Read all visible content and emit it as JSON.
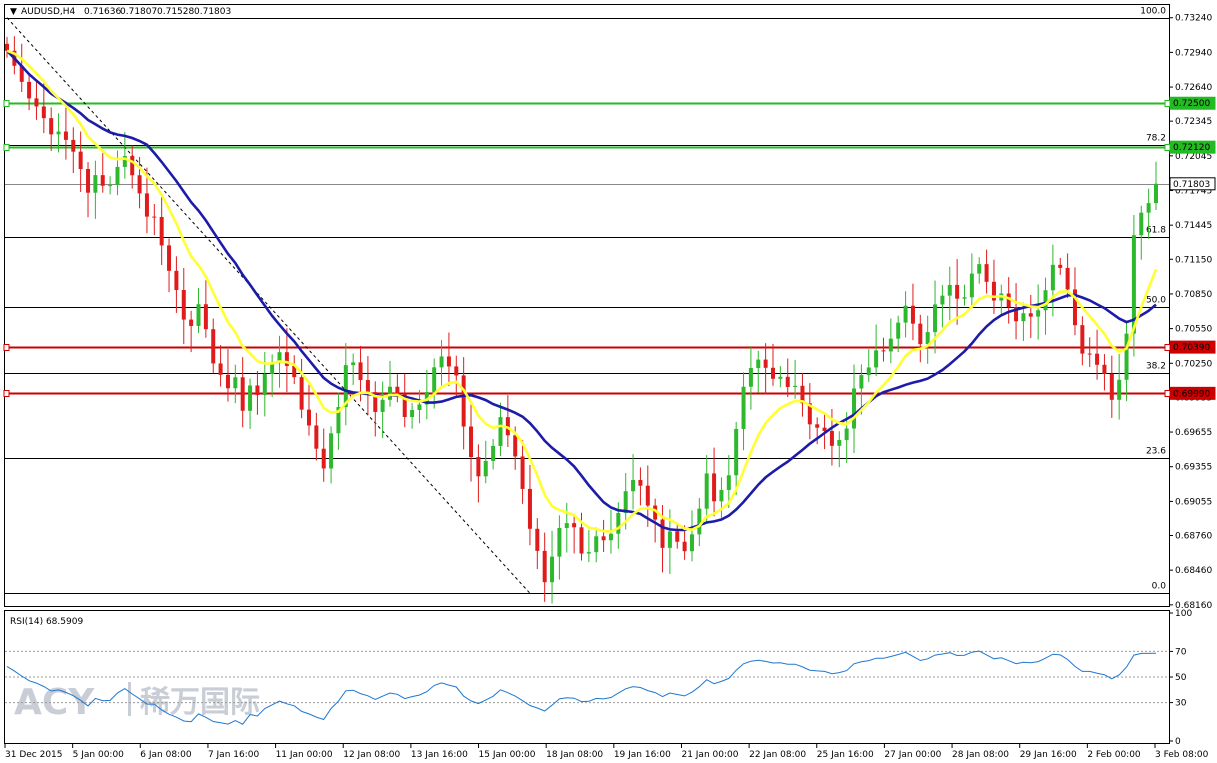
{
  "header": {
    "symbol": "AUDUSD,H4",
    "open": "0.71636",
    "high": "0.71807",
    "low": "0.71528",
    "close": "0.71803"
  },
  "rsi_header": "RSI(14) 68.5909",
  "watermark": {
    "brand": "ACY",
    "chinese": "稀万国际"
  },
  "colors": {
    "up": "#2db82d",
    "down": "#e01b1b",
    "ma_fast": "#ffff33",
    "ma_slow": "#1c1ca8",
    "support": "#cc0000",
    "resistance": "#22bb22",
    "rsi": "#1e78d2",
    "fib": "#000000"
  },
  "chart_data": [
    {
      "type": "candlestick",
      "title": "AUDUSD,H4",
      "ylim": [
        0.6815,
        0.7335
      ],
      "y_ticks": [
        "0.73240",
        "0.72940",
        "0.72640",
        "0.72345",
        "0.72045",
        "0.71745",
        "0.71445",
        "0.71150",
        "0.70850",
        "0.70550",
        "0.70250",
        "0.69955",
        "0.69655",
        "0.69355",
        "0.69055",
        "0.68760",
        "0.68460",
        "0.68160"
      ],
      "x_labels": [
        "31 Dec 2015",
        "5 Jan 00:00",
        "6 Jan 08:00",
        "7 Jan 16:00",
        "11 Jan 00:00",
        "12 Jan 08:00",
        "13 Jan 16:00",
        "15 Jan 00:00",
        "18 Jan 08:00",
        "19 Jan 16:00",
        "21 Jan 00:00",
        "22 Jan 08:00",
        "25 Jan 16:00",
        "27 Jan 00:00",
        "28 Jan 08:00",
        "29 Jan 16:00",
        "2 Feb 00:00",
        "3 Feb 08:00"
      ],
      "series": [
        {
          "name": "AUDUSD,H4",
          "close": [
            0.72954,
            0.72824,
            0.72685,
            0.72542,
            0.72472,
            0.72371,
            0.72231,
            0.72255,
            0.72183,
            0.72081,
            0.71931,
            0.71726,
            0.71878,
            0.71786,
            0.71792,
            0.71949,
            0.72043,
            0.71877,
            0.7172,
            0.71519,
            0.71516,
            0.7127,
            0.7105,
            0.70884,
            0.70628,
            0.70573,
            0.70761,
            0.70545,
            0.70249,
            0.7015,
            0.70034,
            0.70129,
            0.69839,
            0.70058,
            0.69975,
            0.70157,
            0.70251,
            0.70346,
            0.70227,
            0.7013,
            0.69849,
            0.69712,
            0.69511,
            0.6934,
            0.69644,
            0.69871,
            0.70234,
            0.70258,
            0.70105,
            0.70001,
            0.69829,
            0.69934,
            0.70047,
            0.69987,
            0.69785,
            0.69846,
            0.69894,
            0.70001,
            0.70215,
            0.70309,
            0.70223,
            0.70145,
            0.69703,
            0.69439,
            0.69272,
            0.69405,
            0.69535,
            0.69784,
            0.69627,
            0.69444,
            0.69163,
            0.68818,
            0.68627,
            0.68356,
            0.68577,
            0.68825,
            0.68867,
            0.68831,
            0.68604,
            0.68616,
            0.68753,
            0.68719,
            0.68775,
            0.68955,
            0.69143,
            0.6924,
            0.69191,
            0.69019,
            0.68898,
            0.68653,
            0.68795,
            0.68706,
            0.68624,
            0.6877,
            0.68992,
            0.69297,
            0.69056,
            0.69154,
            0.69281,
            0.69682,
            0.70047,
            0.70209,
            0.70282,
            0.70211,
            0.70116,
            0.70133,
            0.70045,
            0.70055,
            0.69904,
            0.69722,
            0.69693,
            0.69664,
            0.69536,
            0.69586,
            0.69686,
            0.70032,
            0.70148,
            0.70214,
            0.70362,
            0.70353,
            0.70463,
            0.70602,
            0.70748,
            0.70593,
            0.70416,
            0.7052,
            0.70759,
            0.70835,
            0.70928,
            0.70809,
            0.70821,
            0.71026,
            0.71108,
            0.70955,
            0.70793,
            0.70854,
            0.70736,
            0.70614,
            0.70683,
            0.70654,
            0.70709,
            0.70882,
            0.71102,
            0.71075,
            0.70889,
            0.7058,
            0.70334,
            0.70333,
            0.70237,
            0.70158,
            0.69934,
            0.70107,
            0.70507,
            0.71358,
            0.71553,
            0.71636,
            0.71803
          ]
        }
      ],
      "moving_averages": [
        {
          "name": "MA fast",
          "color": "yellow"
        },
        {
          "name": "MA slow",
          "color": "blue"
        }
      ],
      "fibonacci": [
        {
          "level": "100.0",
          "price": 0.7324
        },
        {
          "level": "78.2",
          "price": 0.7214
        },
        {
          "level": "61.8",
          "price": 0.7134
        },
        {
          "level": "50.0",
          "price": 0.7074
        },
        {
          "level": "38.2",
          "price": 0.7017
        },
        {
          "level": "23.6",
          "price": 0.6943
        },
        {
          "level": "0.0",
          "price": 0.6826
        }
      ],
      "horizontal_levels": [
        {
          "label": "0.72500",
          "price": 0.725,
          "kind": "resistance"
        },
        {
          "label": "0.72120",
          "price": 0.7212,
          "kind": "resistance"
        },
        {
          "label": "0.71803",
          "price": 0.71803,
          "kind": "current"
        },
        {
          "label": "0.70390",
          "price": 0.7039,
          "kind": "support"
        },
        {
          "label": "0.69990",
          "price": 0.6999,
          "kind": "support"
        }
      ],
      "trendline": {
        "from": {
          "bar": 0,
          "price": 0.7324
        },
        "to": {
          "bar": 71,
          "price": 0.6826
        },
        "style": "dashed"
      },
      "legend": "top-left"
    },
    {
      "type": "line",
      "title": "RSI(14) 68.5909",
      "ylim": [
        0,
        100
      ],
      "y_ticks": [
        "100",
        "70",
        "50",
        "30",
        "0"
      ],
      "levels": [
        70,
        50,
        30
      ],
      "series": [
        {
          "name": "RSI(14)",
          "values": [
            58.3,
            54.6,
            50.8,
            47.1,
            45.2,
            42.6,
            39.1,
            39.9,
            38,
            35.4,
            31.8,
            27.4,
            33.3,
            31.5,
            31.7,
            37.6,
            40.9,
            36.7,
            33,
            28.8,
            28.8,
            24.3,
            20.9,
            18.6,
            15.6,
            15.1,
            21.2,
            18.5,
            15.2,
            14.2,
            13.2,
            15.9,
            13.1,
            20.6,
            19.5,
            25.4,
            28.3,
            31.2,
            29.1,
            27.5,
            23.1,
            21.2,
            18.7,
            16.8,
            25.4,
            31.1,
            39.2,
            39.7,
            37,
            35.3,
            32.5,
            35,
            37.5,
            36.5,
            33.1,
            34.7,
            35.9,
            38.5,
            43.4,
            45.4,
            43.7,
            42.2,
            35,
            31.3,
            29.2,
            32.1,
            34.9,
            40,
            37.7,
            35.1,
            31.5,
            27.7,
            25.8,
            23.4,
            28,
            32.9,
            33.8,
            33.4,
            30.8,
            31,
            33.3,
            32.9,
            34,
            37.4,
            40.8,
            42.5,
            41.8,
            39.4,
            37.8,
            34.7,
            37.5,
            36.3,
            35.2,
            38.1,
            42.4,
            47.9,
            44.8,
            46.6,
            48.9,
            55.3,
            60.3,
            62.3,
            63.1,
            62.2,
            60.9,
            61.1,
            59.9,
            60,
            57.9,
            55.3,
            54.8,
            54.4,
            52.6,
            53.4,
            55,
            60.3,
            61.9,
            62.8,
            64.7,
            64.6,
            66,
            67.6,
            69.3,
            66.2,
            62.9,
            64.2,
            67.1,
            68,
            69,
            66.8,
            67,
            69.4,
            70.3,
            67.3,
            64.2,
            65,
            62.7,
            60.4,
            61.6,
            61.1,
            62,
            64.7,
            67.8,
            67.3,
            63.7,
            58.3,
            54.4,
            54.4,
            53,
            51.8,
            48.6,
            51.7,
            57.7,
            67.1,
            68.4,
            68.4,
            68.6
          ]
        }
      ]
    }
  ]
}
